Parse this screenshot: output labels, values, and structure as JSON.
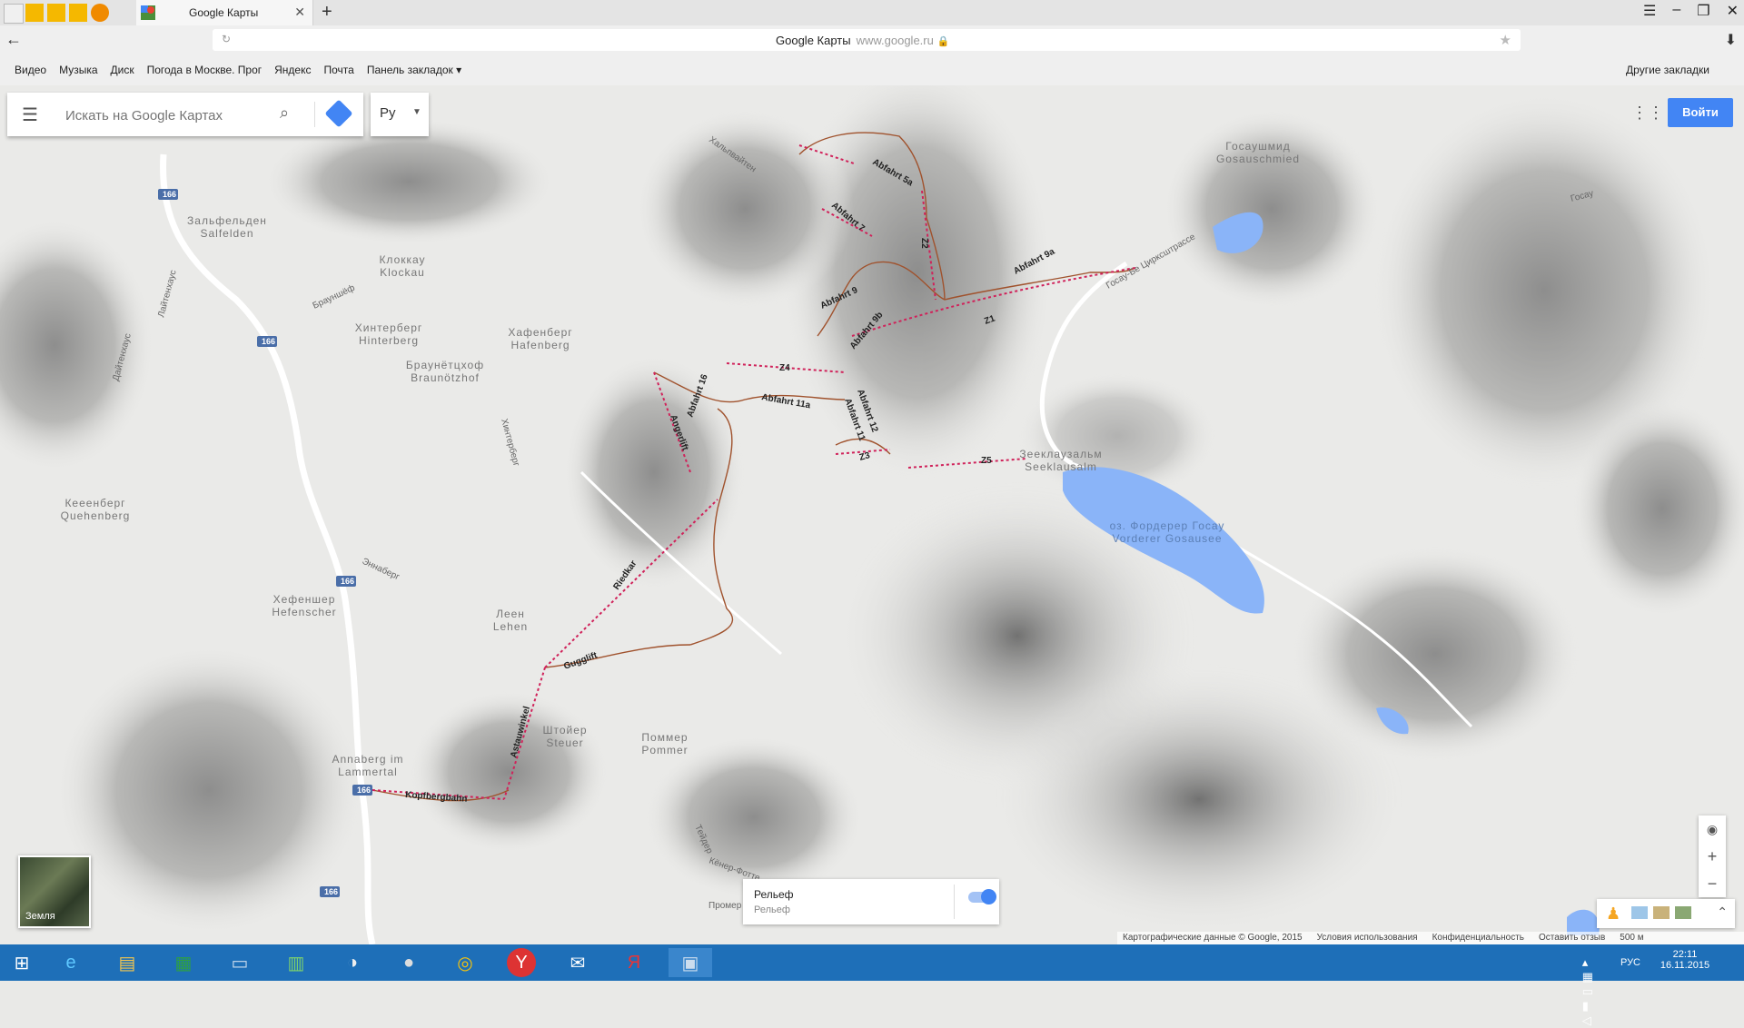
{
  "browser": {
    "tab_title": "Google Карты",
    "new_tab": "+",
    "address_title": "Google Карты",
    "address_domain": "www.google.ru",
    "bookmarks": [
      "Видео",
      "Музыка",
      "Диск",
      "Погода в Москве. Прог",
      "Яндекс",
      "Почта",
      "Панель закладок ▾"
    ],
    "other_bookmarks": "Другие закладки"
  },
  "search": {
    "placeholder": "Искать на Google Картах",
    "lang": "Ру"
  },
  "header": {
    "signin": "Войти"
  },
  "earth_label": "Земля",
  "layer": {
    "title": "Рельеф",
    "subtitle": "Рельеф",
    "enabled": true
  },
  "footer": {
    "copyright": "Картографические данные © Google, 2015",
    "terms": "Условия использования",
    "privacy": "Конфиденциальность",
    "feedback": "Оставить отзыв",
    "scale": "500 м"
  },
  "taskbar": {
    "lang": "РУС",
    "time": "22:11",
    "date": "16.11.2015"
  },
  "map": {
    "places": [
      {
        "name": "Госаушмид",
        "alt": "Gosauschmied"
      },
      {
        "name": "Зальфельден",
        "alt": "Salfelden"
      },
      {
        "name": "Клоккау",
        "alt": "Klockau"
      },
      {
        "name": "Хинтерберг",
        "alt": "Hinterberg"
      },
      {
        "name": "Хафенберг",
        "alt": "Hafenberg"
      },
      {
        "name": "Браунётцхоф",
        "alt": "Braunötzhof"
      },
      {
        "name": "Кееенберг",
        "alt": "Quehenberg"
      },
      {
        "name": "Хефеншер",
        "alt": "Hefenscher"
      },
      {
        "name": "Леен",
        "alt": "Lehen"
      },
      {
        "name": "Штойер",
        "alt": "Steuer"
      },
      {
        "name": "Поммер",
        "alt": "Pommer"
      },
      {
        "name": "Annaberg im",
        "alt": "Lammertal"
      },
      {
        "name": "Зееклаузальм",
        "alt": "Seeklausalm"
      },
      {
        "name": "оз. Фордерер Госау",
        "alt": "Vorderer Gosausee"
      }
    ],
    "road_shields": [
      "166",
      "166",
      "166",
      "166",
      "166"
    ],
    "pistes": [
      "Abfahrt 5a",
      "Abfahrt 7",
      "Abfahrt 9",
      "Abfahrt 9a",
      "Abfahrt 9b",
      "Abfahrt 11a",
      "Abfahrt 11",
      "Abfahrt 12",
      "Abfahrt 16",
      "Z4",
      "Z1",
      "Z2",
      "Z3",
      "Z5",
      "Angerlift",
      "Riedkar",
      "Gugglift",
      "Astauwinkel",
      "Kopfbergbahn"
    ],
    "road_labels": [
      "Госау-Бе Цирксштрассе",
      "Госау",
      "Хальпвайтен",
      "Брауншёф",
      "Хинтерберг",
      "Лайтенхаус",
      "Дайтенхаус",
      "Эннаберг",
      "Тейдер",
      "Кёнер-Фотте",
      "Промер"
    ]
  }
}
